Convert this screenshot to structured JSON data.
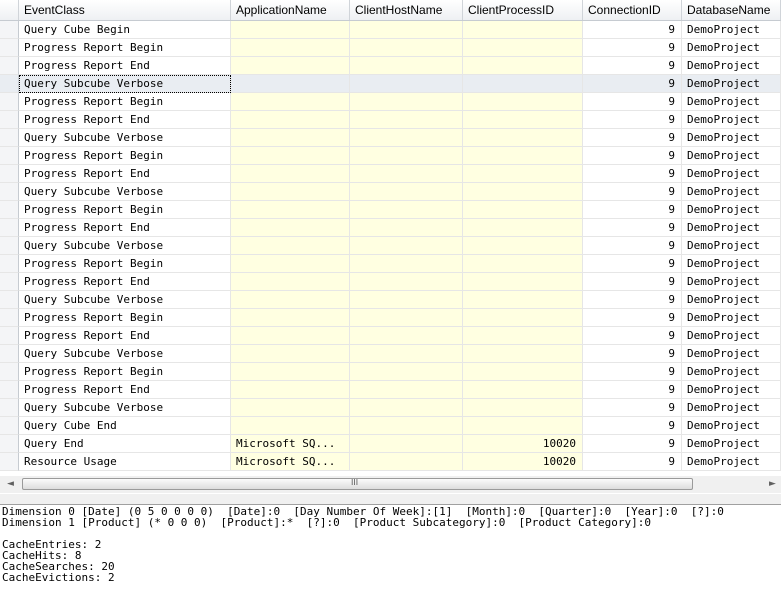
{
  "columns": [
    "EventClass",
    "ApplicationName",
    "ClientHostName",
    "ClientProcessID",
    "ConnectionID",
    "DatabaseName"
  ],
  "rows": [
    {
      "event": "Query Cube Begin",
      "app": "",
      "host": "",
      "pid": "",
      "conn": "9",
      "db": "DemoProject"
    },
    {
      "event": "Progress Report Begin",
      "app": "",
      "host": "",
      "pid": "",
      "conn": "9",
      "db": "DemoProject"
    },
    {
      "event": "Progress Report End",
      "app": "",
      "host": "",
      "pid": "",
      "conn": "9",
      "db": "DemoProject"
    },
    {
      "event": "Query Subcube Verbose",
      "app": "",
      "host": "",
      "pid": "",
      "conn": "9",
      "db": "DemoProject"
    },
    {
      "event": "Progress Report Begin",
      "app": "",
      "host": "",
      "pid": "",
      "conn": "9",
      "db": "DemoProject"
    },
    {
      "event": "Progress Report End",
      "app": "",
      "host": "",
      "pid": "",
      "conn": "9",
      "db": "DemoProject"
    },
    {
      "event": "Query Subcube Verbose",
      "app": "",
      "host": "",
      "pid": "",
      "conn": "9",
      "db": "DemoProject"
    },
    {
      "event": "Progress Report Begin",
      "app": "",
      "host": "",
      "pid": "",
      "conn": "9",
      "db": "DemoProject"
    },
    {
      "event": "Progress Report End",
      "app": "",
      "host": "",
      "pid": "",
      "conn": "9",
      "db": "DemoProject"
    },
    {
      "event": "Query Subcube Verbose",
      "app": "",
      "host": "",
      "pid": "",
      "conn": "9",
      "db": "DemoProject"
    },
    {
      "event": "Progress Report Begin",
      "app": "",
      "host": "",
      "pid": "",
      "conn": "9",
      "db": "DemoProject"
    },
    {
      "event": "Progress Report End",
      "app": "",
      "host": "",
      "pid": "",
      "conn": "9",
      "db": "DemoProject"
    },
    {
      "event": "Query Subcube Verbose",
      "app": "",
      "host": "",
      "pid": "",
      "conn": "9",
      "db": "DemoProject"
    },
    {
      "event": "Progress Report Begin",
      "app": "",
      "host": "",
      "pid": "",
      "conn": "9",
      "db": "DemoProject"
    },
    {
      "event": "Progress Report End",
      "app": "",
      "host": "",
      "pid": "",
      "conn": "9",
      "db": "DemoProject"
    },
    {
      "event": "Query Subcube Verbose",
      "app": "",
      "host": "",
      "pid": "",
      "conn": "9",
      "db": "DemoProject"
    },
    {
      "event": "Progress Report Begin",
      "app": "",
      "host": "",
      "pid": "",
      "conn": "9",
      "db": "DemoProject"
    },
    {
      "event": "Progress Report End",
      "app": "",
      "host": "",
      "pid": "",
      "conn": "9",
      "db": "DemoProject"
    },
    {
      "event": "Query Subcube Verbose",
      "app": "",
      "host": "",
      "pid": "",
      "conn": "9",
      "db": "DemoProject"
    },
    {
      "event": "Progress Report Begin",
      "app": "",
      "host": "",
      "pid": "",
      "conn": "9",
      "db": "DemoProject"
    },
    {
      "event": "Progress Report End",
      "app": "",
      "host": "",
      "pid": "",
      "conn": "9",
      "db": "DemoProject"
    },
    {
      "event": "Query Subcube Verbose",
      "app": "",
      "host": "",
      "pid": "",
      "conn": "9",
      "db": "DemoProject"
    },
    {
      "event": "Query Cube End",
      "app": "",
      "host": "",
      "pid": "",
      "conn": "9",
      "db": "DemoProject"
    },
    {
      "event": "Query End",
      "app": "Microsoft SQ...",
      "host": "",
      "pid": "10020",
      "conn": "9",
      "db": "DemoProject"
    },
    {
      "event": "Resource Usage",
      "app": "Microsoft SQ...",
      "host": "",
      "pid": "10020",
      "conn": "9",
      "db": "DemoProject"
    }
  ],
  "selected_row": 3,
  "scrollbar": {
    "left_arrow": "◄",
    "right_arrow": "►",
    "grip": "III"
  },
  "detail_lines": [
    "Dimension 0 [Date] (0 5 0 0 0 0)  [Date]:0  [Day Number Of Week]:[1]  [Month]:0  [Quarter]:0  [Year]:0  [?]:0",
    "Dimension 1 [Product] (* 0 0 0)  [Product]:*  [?]:0  [Product Subcategory]:0  [Product Category]:0",
    "",
    "CacheEntries: 2",
    "CacheHits: 8",
    "CacheSearches: 20",
    "CacheEvictions: 2"
  ],
  "colors": {
    "yellow_cell": "#ffffe1",
    "selected_row": "#e9edf2",
    "header_border": "#c6cbd1"
  }
}
